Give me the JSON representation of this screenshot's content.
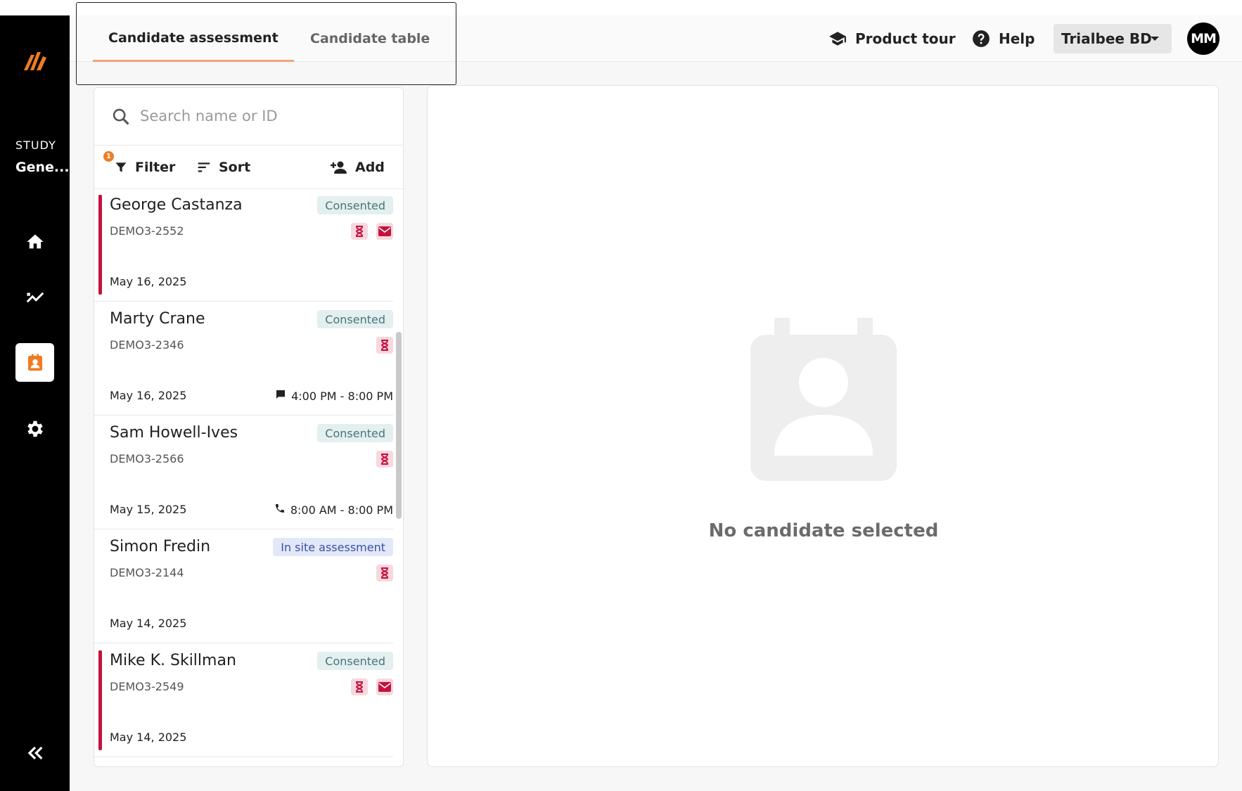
{
  "rail": {
    "study_label": "STUDY",
    "study_name": "Gene...",
    "nav": [
      "home-icon",
      "analytics-icon",
      "candidates-icon",
      "settings-icon"
    ],
    "active_index": 2,
    "colors": {
      "background": "#000000",
      "accent": "#f07b22"
    }
  },
  "header": {
    "tabs": [
      {
        "label": "Candidate assessment",
        "active": true
      },
      {
        "label": "Candidate table",
        "active": false
      }
    ],
    "product_tour_label": "Product tour",
    "help_label": "Help",
    "org_label": "Trialbee BD",
    "avatar_initials": "MM"
  },
  "search": {
    "placeholder": "Search name or ID"
  },
  "toolbar": {
    "filter_label": "Filter",
    "filter_count": "1",
    "sort_label": "Sort",
    "add_label": "Add"
  },
  "candidates": [
    {
      "name": "George Castanza",
      "id": "DEMO3-2552",
      "status": "Consented",
      "date": "May 16, 2025",
      "flagged": true,
      "icons": [
        "hourglass-icon",
        "mail-icon"
      ],
      "contact": "",
      "contact_icon": ""
    },
    {
      "name": "Marty Crane",
      "id": "DEMO3-2346",
      "status": "Consented",
      "date": "May 16, 2025",
      "flagged": false,
      "icons": [
        "hourglass-icon"
      ],
      "contact": "4:00 PM - 8:00 PM",
      "contact_icon": "message-icon"
    },
    {
      "name": "Sam Howell-Ives",
      "id": "DEMO3-2566",
      "status": "Consented",
      "date": "May 15, 2025",
      "flagged": false,
      "icons": [
        "hourglass-icon"
      ],
      "contact": "8:00 AM - 8:00 PM",
      "contact_icon": "phone-icon"
    },
    {
      "name": "Simon Fredin",
      "id": "DEMO3-2144",
      "status": "In site assessment",
      "date": "May 14, 2025",
      "flagged": false,
      "icons": [
        "hourglass-icon"
      ],
      "contact": "",
      "contact_icon": ""
    },
    {
      "name": "Mike K. Skillman",
      "id": "DEMO3-2549",
      "status": "Consented",
      "date": "May 14, 2025",
      "flagged": true,
      "icons": [
        "hourglass-icon",
        "mail-icon"
      ],
      "contact": "",
      "contact_icon": ""
    }
  ],
  "detail": {
    "empty_text": "No candidate selected"
  },
  "colors": {
    "flag": "#c4123e",
    "consented_bg": "#e4efef",
    "consented_text": "#49757a",
    "insite_bg": "#e3e8f8",
    "insite_text": "#3b4fa5",
    "tab_underline": "#f4a27a"
  }
}
